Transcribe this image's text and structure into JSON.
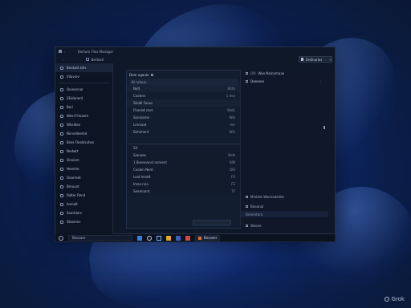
{
  "window": {
    "title": "Bertwin Files Manager",
    "breadcrumb": "Bertocé",
    "view_button": "Ordinarios"
  },
  "sidebar": {
    "items": [
      {
        "label": "Beokatt kills",
        "icon": "home-icon"
      },
      {
        "label": "Vilovine",
        "icon": "desktop-icon"
      },
      {
        "label": "Ooinennar",
        "icon": "folder-icon"
      },
      {
        "label": "2Eelanerd",
        "icon": "folder-icon"
      },
      {
        "label": "Berl",
        "icon": "folder-icon"
      },
      {
        "label": "Weel Flmaem",
        "icon": "pictures-icon"
      },
      {
        "label": "Wlielites",
        "icon": "music-icon"
      },
      {
        "label": "Niirvelleemd",
        "icon": "video-icon"
      },
      {
        "label": "Bses Flooktruhes",
        "icon": "folder-icon"
      },
      {
        "label": "Nedwtt",
        "icon": "network-icon"
      },
      {
        "label": "Onoiom",
        "icon": "drive-icon"
      },
      {
        "label": "Heemle",
        "icon": "drive-icon"
      },
      {
        "label": "Ooorreet",
        "icon": "drive-icon"
      },
      {
        "label": "Bmuunt",
        "icon": "drive-icon"
      },
      {
        "label": "Rolter Rend",
        "icon": "drive-icon"
      },
      {
        "label": "Ivenalt",
        "icon": "drive-icon"
      },
      {
        "label": "Searblars",
        "icon": "drive-icon"
      },
      {
        "label": "Stoomns",
        "icon": "drive-icon"
      }
    ]
  },
  "center": {
    "header": "Dem ngaule",
    "subheader": "Bi ncloun",
    "rows": [
      {
        "label": "Nelt",
        "value": "Ritth",
        "shade": true
      },
      {
        "label": "Cooters",
        "value": "1 deo",
        "shade": false
      },
      {
        "label": "Stiddl Fanes",
        "value": "",
        "shade": true
      },
      {
        "label": "Fhenlet  met",
        "value": "Welti",
        "shade": false
      },
      {
        "label": "Sonnlame",
        "value": "Wle",
        "shade": false
      },
      {
        "label": "Lmmaet",
        "value": "Aer",
        "shade": false
      },
      {
        "label": "Bimiment",
        "value": "Wle",
        "shade": false
      }
    ],
    "section2_title": "Sit",
    "section2_rows": [
      {
        "label": "Sienaee",
        "value": "Nett"
      },
      {
        "label": "1 Bueneanst  noment",
        "value": "SIM"
      },
      {
        "label": "Coolen Nent",
        "value": "DIS"
      },
      {
        "label": "Leat  lenett",
        "value": "FR"
      },
      {
        "label": "lmeo  nna",
        "value": "FE"
      },
      {
        "label": "Seemnant",
        "value": "TF"
      }
    ]
  },
  "right_panel": {
    "head_code": "DM",
    "head_label": "Wee Nainomaae",
    "row_label": "Deerene",
    "list": [
      {
        "label": "Minldnt Weenadelele"
      },
      {
        "label": "Boeanal"
      },
      {
        "label": "Deonnnt"
      },
      {
        "label": "Woone"
      }
    ],
    "footer": "Breemtent"
  },
  "taskbar": {
    "search_text": "Boocaer",
    "app_label": "Bocoeer"
  },
  "watermark": "Grok"
}
